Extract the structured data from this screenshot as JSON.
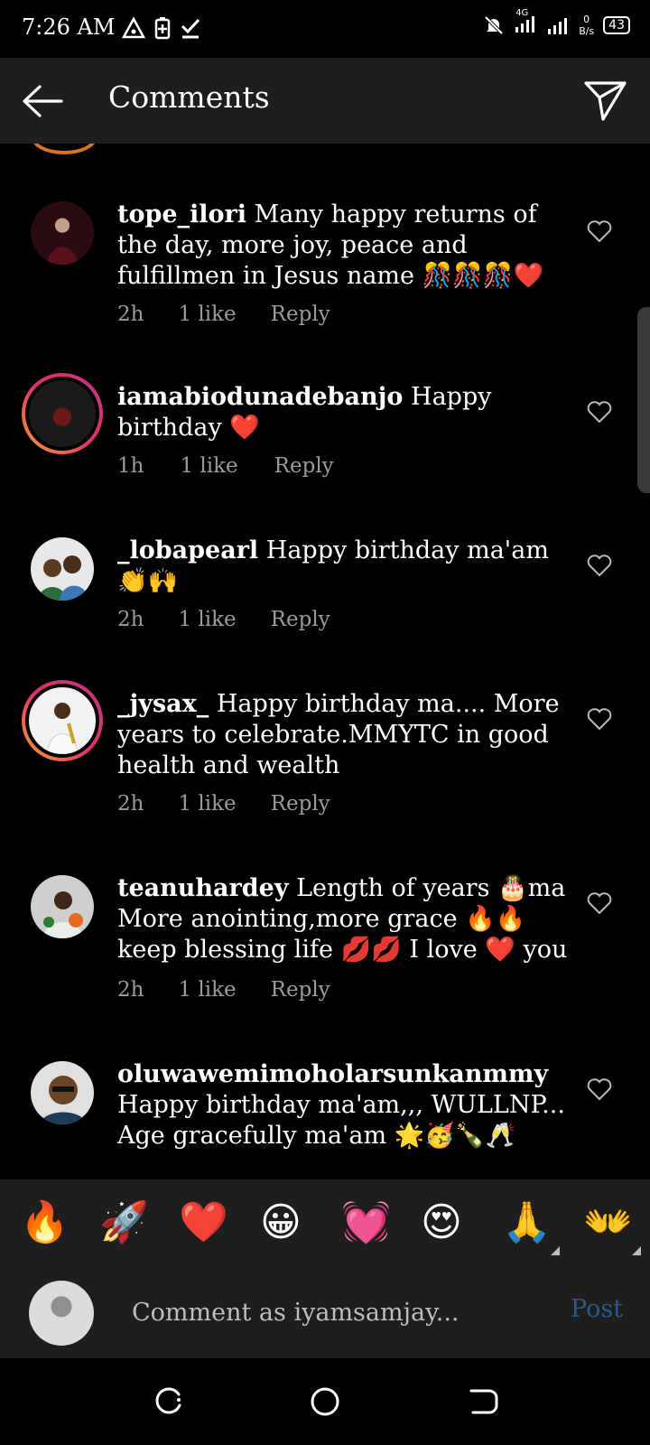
{
  "status_bar": {
    "time": "7:26 AM",
    "network": "4G",
    "speed_value": "0",
    "speed_unit": "B/s",
    "battery": "43"
  },
  "header": {
    "title": "Comments"
  },
  "comments": [
    {
      "username": "tope_ilori",
      "text": "Many happy returns of the day, more joy, peace and fulfillmen in Jesus name 🎊🎊🎊❤️",
      "time": "2h",
      "likes": "1 like",
      "reply": "Reply"
    },
    {
      "username": "iamabiodunadebanjo",
      "text": "Happy birthday ❤️",
      "time": "1h",
      "likes": "1 like",
      "reply": "Reply"
    },
    {
      "username": "_lobapearl",
      "text": "Happy birthday ma'am 👏🙌",
      "time": "2h",
      "likes": "1 like",
      "reply": "Reply"
    },
    {
      "username": "_jysax_",
      "text": "Happy birthday ma.... More years to celebrate.MMYTC in good health and wealth",
      "time": "2h",
      "likes": "1 like",
      "reply": "Reply"
    },
    {
      "username": "teanuhardey",
      "text": "Length of years 🎂ma More anointing,more grace 🔥🔥 keep blessing life 💋💋 I love ❤️ you",
      "time": "2h",
      "likes": "1 like",
      "reply": "Reply"
    },
    {
      "username": "oluwawemimoholarsunkanmmy",
      "text": "Happy birthday ma'am,,, WULLNP... Age gracefully ma'am 🌟🥳🍾🥂"
    }
  ],
  "emoji_bar": [
    "🔥",
    "🚀",
    "❤️",
    "😀",
    "💓",
    "😍",
    "🙏",
    "👐"
  ],
  "composer": {
    "placeholder": "Comment as iyamsamjay...",
    "post_label": "Post"
  }
}
